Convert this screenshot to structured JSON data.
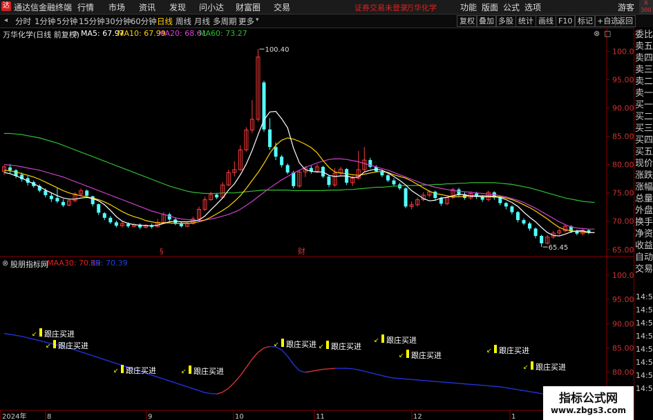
{
  "app": {
    "title": "通达信金融终端",
    "menu": [
      "行情",
      "市场",
      "资讯",
      "发现",
      "问小达",
      "财富圈",
      "交易"
    ],
    "status_msg": "证券交易未登录",
    "stock_name_red": "万华化学",
    "right_menu": [
      "功能",
      "版面",
      "公式",
      "选项"
    ],
    "guest": "游客",
    "corner": "R 300"
  },
  "toolbar": {
    "periods": [
      "分时",
      "1分钟",
      "5分钟",
      "15分钟",
      "30分钟",
      "60分钟",
      "日线",
      "周线",
      "月线",
      "多周期",
      "更多"
    ],
    "active_period": "日线",
    "right_buttons": [
      "复权",
      "叠加",
      "多股",
      "统计",
      "画线",
      "F10",
      "标记",
      "+自选",
      "返回"
    ]
  },
  "legend": {
    "stock": "万华化学(日线 前复权)",
    "ma5": "MA5: 67.97",
    "ma10": "MA10: 67.99",
    "ma20": "MA20: 68.61",
    "ma60": "MA60: 73.27",
    "colors": {
      "ma5": "#ffffff",
      "ma10": "#ffd200",
      "ma20": "#e040e0",
      "ma60": "#30c030"
    }
  },
  "indicator": {
    "name": "股朋指标网",
    "maa30": "MAA30: 70.39",
    "kb": "KB: 70.39",
    "signal_label": "跟庄买进"
  },
  "markers": {
    "s": "§",
    "cai": "财"
  },
  "annotations": {
    "high": "100.40",
    "low": "65.45"
  },
  "price_axis": [
    "100.0",
    "95.00",
    "90.00",
    "85.00",
    "80.00",
    "75.00",
    "70.00",
    "65.00"
  ],
  "ind_axis": [
    "100.0",
    "95.00",
    "90.00",
    "85.00",
    "80.00",
    "75.00"
  ],
  "x_labels": [
    "2024年",
    "8",
    "9",
    "10",
    "11",
    "12",
    "1"
  ],
  "right_panel": {
    "items": [
      "委比",
      "卖五",
      "卖四",
      "卖三",
      "卖二",
      "卖一",
      "买一",
      "买二",
      "买三",
      "买四",
      "买五",
      "现价",
      "涨跌",
      "涨幅",
      "总量",
      "外盘",
      "换手",
      "净资",
      "收益",
      "自动",
      "交易"
    ],
    "times": [
      "14:56",
      "14:56",
      "14:56",
      "14:56",
      "14:56",
      "14:56",
      "14:56",
      "14:56"
    ]
  },
  "watermark": {
    "line1": "指标公式网",
    "line2": "www.zbgs3.com"
  },
  "chart_data": {
    "type": "candlestick",
    "ylim": [
      64,
      102
    ],
    "candles": [
      [
        78.8,
        79.6,
        78.2,
        79.9
      ],
      [
        79.5,
        79.0,
        78.5,
        80.1
      ],
      [
        79.0,
        78.0,
        77.6,
        79.2
      ],
      [
        78.2,
        77.4,
        77.0,
        78.6
      ],
      [
        77.6,
        76.8,
        76.3,
        78.0
      ],
      [
        76.9,
        76.2,
        75.9,
        77.2
      ],
      [
        76.2,
        75.4,
        75.1,
        76.5
      ],
      [
        75.4,
        74.6,
        74.2,
        75.8
      ],
      [
        74.5,
        73.9,
        73.4,
        75.0
      ],
      [
        74.1,
        73.5,
        73.2,
        75.8
      ],
      [
        73.4,
        72.8,
        72.5,
        73.9
      ],
      [
        72.8,
        73.6,
        72.6,
        74.0
      ],
      [
        73.6,
        74.8,
        73.4,
        75.1
      ],
      [
        74.8,
        75.4,
        74.4,
        75.8
      ],
      [
        75.4,
        74.5,
        74.1,
        75.6
      ],
      [
        74.4,
        73.0,
        72.6,
        74.5
      ],
      [
        73.0,
        71.5,
        71.1,
        73.1
      ],
      [
        71.4,
        70.6,
        70.2,
        71.6
      ],
      [
        70.6,
        69.8,
        69.5,
        70.9
      ],
      [
        69.8,
        69.2,
        68.9,
        70.1
      ],
      [
        69.2,
        69.6,
        68.9,
        69.9
      ],
      [
        69.5,
        69.1,
        68.8,
        69.8
      ],
      [
        69.1,
        69.4,
        68.9,
        69.7
      ],
      [
        69.4,
        68.9,
        68.6,
        69.6
      ],
      [
        68.9,
        69.3,
        68.7,
        69.5
      ],
      [
        69.3,
        69.0,
        68.7,
        69.6
      ],
      [
        69.0,
        69.8,
        68.9,
        70.4
      ],
      [
        69.8,
        71.2,
        69.6,
        71.6
      ],
      [
        71.2,
        70.3,
        70.0,
        71.5
      ],
      [
        70.3,
        69.6,
        69.3,
        70.6
      ],
      [
        69.6,
        69.1,
        68.9,
        69.9
      ],
      [
        69.1,
        69.6,
        68.9,
        69.9
      ],
      [
        69.6,
        70.4,
        69.4,
        70.8
      ],
      [
        70.4,
        72.1,
        70.2,
        72.6
      ],
      [
        72.1,
        73.8,
        71.8,
        74.3
      ],
      [
        73.8,
        74.7,
        73.6,
        75.2
      ],
      [
        74.7,
        74.2,
        73.9,
        75.0
      ],
      [
        74.2,
        76.4,
        74.1,
        76.9
      ],
      [
        76.4,
        78.6,
        76.2,
        79.1
      ],
      [
        78.6,
        79.1,
        77.9,
        80.6
      ],
      [
        79.1,
        82.6,
        78.9,
        83.4
      ],
      [
        82.6,
        86.1,
        82.3,
        86.6
      ],
      [
        86.1,
        88.0,
        85.6,
        91.4
      ],
      [
        88.0,
        99.0,
        87.6,
        100.4
      ],
      [
        94.5,
        86.2,
        85.8,
        94.8
      ],
      [
        86.2,
        83.1,
        82.6,
        88.2
      ],
      [
        83.1,
        81.4,
        80.8,
        83.9
      ],
      [
        81.4,
        79.9,
        79.5,
        81.7
      ],
      [
        79.9,
        78.6,
        78.3,
        80.2
      ],
      [
        78.6,
        76.2,
        75.8,
        78.9
      ],
      [
        76.2,
        78.7,
        75.9,
        79.1
      ],
      [
        78.7,
        79.4,
        77.8,
        79.7
      ],
      [
        79.4,
        78.8,
        78.4,
        79.8
      ],
      [
        78.8,
        79.6,
        78.5,
        80.1
      ],
      [
        79.6,
        77.9,
        77.6,
        79.8
      ],
      [
        77.9,
        76.4,
        76.0,
        78.1
      ],
      [
        76.4,
        78.5,
        76.1,
        79.4
      ],
      [
        78.5,
        79.2,
        78.0,
        79.6
      ],
      [
        79.2,
        76.8,
        76.4,
        79.4
      ],
      [
        76.8,
        77.6,
        76.2,
        78.0
      ],
      [
        77.6,
        79.1,
        77.3,
        82.4
      ],
      [
        79.1,
        80.8,
        78.8,
        83.1
      ],
      [
        80.8,
        79.6,
        79.3,
        81.2
      ],
      [
        79.6,
        78.8,
        78.6,
        79.9
      ],
      [
        78.8,
        78.1,
        77.8,
        79.1
      ],
      [
        78.1,
        77.2,
        76.9,
        78.3
      ],
      [
        77.2,
        76.5,
        76.1,
        77.6
      ],
      [
        76.5,
        75.8,
        75.5,
        76.8
      ],
      [
        75.8,
        72.6,
        72.3,
        76.0
      ],
      [
        72.6,
        72.9,
        72.1,
        73.5
      ],
      [
        72.9,
        73.8,
        72.6,
        74.2
      ],
      [
        73.8,
        74.6,
        73.5,
        75.1
      ],
      [
        74.6,
        75.2,
        74.2,
        75.5
      ],
      [
        75.2,
        74.1,
        73.8,
        75.4
      ],
      [
        74.1,
        73.1,
        72.7,
        74.3
      ],
      [
        73.1,
        74.2,
        72.8,
        74.6
      ],
      [
        74.2,
        75.6,
        73.9,
        75.9
      ],
      [
        75.6,
        74.7,
        74.4,
        75.9
      ],
      [
        74.7,
        74.1,
        73.8,
        75.1
      ],
      [
        74.1,
        74.9,
        73.8,
        75.3
      ],
      [
        74.9,
        74.3,
        73.9,
        75.2
      ],
      [
        74.3,
        73.8,
        73.4,
        74.6
      ],
      [
        73.8,
        75.1,
        73.5,
        75.4
      ],
      [
        75.1,
        74.2,
        73.8,
        75.3
      ],
      [
        74.2,
        73.2,
        72.8,
        74.4
      ],
      [
        73.2,
        72.6,
        72.1,
        73.4
      ],
      [
        72.6,
        71.6,
        71.2,
        72.8
      ],
      [
        71.6,
        70.2,
        69.8,
        71.8
      ],
      [
        70.2,
        69.6,
        69.3,
        70.5
      ],
      [
        69.6,
        68.7,
        68.3,
        69.9
      ],
      [
        68.7,
        67.4,
        67.0,
        68.9
      ],
      [
        67.4,
        66.1,
        65.45,
        67.6
      ],
      [
        66.1,
        67.2,
        65.9,
        67.6
      ],
      [
        67.2,
        67.9,
        66.9,
        68.3
      ],
      [
        67.9,
        68.3,
        67.6,
        68.7
      ],
      [
        68.3,
        69.1,
        68.0,
        69.5
      ],
      [
        69.1,
        68.2,
        67.9,
        69.3
      ],
      [
        68.2,
        67.8,
        67.5,
        68.5
      ],
      [
        67.8,
        68.4,
        67.5,
        68.8
      ],
      [
        68.4,
        68.0,
        67.7,
        68.6
      ]
    ],
    "ma5": [
      78.6,
      78.4,
      78.0,
      77.6,
      77.1,
      76.6,
      76.1,
      75.5,
      75.0,
      74.5,
      74.1,
      73.9,
      73.9,
      74.1,
      74.2,
      74.0,
      73.6,
      72.9,
      71.9,
      70.8,
      70.0,
      69.6,
      69.4,
      69.3,
      69.2,
      69.2,
      69.3,
      69.6,
      69.9,
      70.0,
      69.9,
      69.9,
      70.0,
      70.2,
      70.9,
      72.0,
      73.0,
      74.1,
      75.5,
      76.6,
      78.2,
      80.1,
      82.5,
      85.3,
      87.9,
      89.3,
      89.4,
      88.1,
      86.5,
      82.9,
      80.3,
      79.1,
      78.8,
      78.7,
      78.7,
      78.1,
      77.9,
      78.0,
      78.0,
      77.7,
      77.8,
      78.7,
      79.0,
      79.2,
      79.0,
      78.5,
      77.9,
      77.2,
      76.4,
      75.4,
      74.7,
      74.0,
      73.6,
      73.7,
      74.1,
      74.2,
      74.5,
      74.7,
      74.7,
      74.4,
      74.4,
      74.3,
      74.3,
      74.3,
      74.2,
      73.8,
      73.3,
      72.6,
      71.6,
      70.7,
      69.9,
      68.9,
      68.0,
      67.5,
      67.4,
      67.7,
      68.1,
      68.3,
      68.3,
      68.0,
      68.0
    ],
    "ma10": [
      79.0,
      78.9,
      78.7,
      78.4,
      78.1,
      77.8,
      77.4,
      76.9,
      76.4,
      75.9,
      75.4,
      75.0,
      74.7,
      74.5,
      74.3,
      74.1,
      73.8,
      73.4,
      72.9,
      72.3,
      71.7,
      71.2,
      70.8,
      70.5,
      70.1,
      69.9,
      69.7,
      69.7,
      69.7,
      69.6,
      69.6,
      69.6,
      69.7,
      69.9,
      70.2,
      70.7,
      71.3,
      71.9,
      72.6,
      73.5,
      74.5,
      75.8,
      77.2,
      78.6,
      80.2,
      82.0,
      83.4,
      84.3,
      84.7,
      84.5,
      84.1,
      83.6,
      83.0,
      82.1,
      80.7,
      79.5,
      78.7,
      78.5,
      78.4,
      78.2,
      78.1,
      78.3,
      78.5,
      78.7,
      78.8,
      78.6,
      78.2,
      77.9,
      77.6,
      77.1,
      76.5,
      75.9,
      75.3,
      74.9,
      74.7,
      74.5,
      74.3,
      74.3,
      74.4,
      74.5,
      74.5,
      74.5,
      74.5,
      74.4,
      74.3,
      74.1,
      73.8,
      73.4,
      72.9,
      72.4,
      71.8,
      71.1,
      70.4,
      69.6,
      68.9,
      68.5,
      68.3,
      68.2,
      68.1,
      68.0,
      68.0
    ],
    "ma20": [
      80.0,
      79.9,
      79.8,
      79.6,
      79.4,
      79.2,
      79.0,
      78.7,
      78.4,
      78.1,
      77.8,
      77.4,
      77.0,
      76.6,
      76.2,
      75.8,
      75.4,
      75.0,
      74.6,
      74.2,
      73.8,
      73.4,
      73.0,
      72.6,
      72.2,
      71.8,
      71.5,
      71.2,
      70.9,
      70.6,
      70.4,
      70.3,
      70.2,
      70.1,
      70.2,
      70.4,
      70.6,
      70.9,
      71.2,
      71.6,
      72.1,
      72.8,
      73.5,
      74.3,
      75.1,
      75.9,
      76.6,
      77.3,
      77.9,
      78.5,
      79.0,
      79.5,
      79.9,
      80.3,
      80.6,
      80.9,
      81.0,
      81.0,
      80.9,
      80.7,
      80.5,
      80.2,
      79.9,
      79.6,
      79.3,
      79.0,
      78.6,
      78.2,
      77.8,
      77.4,
      77.0,
      76.6,
      76.3,
      76.0,
      75.8,
      75.6,
      75.4,
      75.3,
      75.2,
      75.1,
      75.0,
      74.9,
      74.8,
      74.7,
      74.5,
      74.3,
      74.0,
      73.7,
      73.3,
      72.8,
      72.3,
      71.7,
      71.1,
      70.5,
      69.9,
      69.4,
      69.0,
      68.8,
      68.7,
      68.6,
      68.6
    ],
    "ma60": [
      85.5,
      85.5,
      85.4,
      85.3,
      85.1,
      84.9,
      84.7,
      84.4,
      84.1,
      83.8,
      83.4,
      83.0,
      82.6,
      82.2,
      81.8,
      81.4,
      81.0,
      80.6,
      80.2,
      79.8,
      79.4,
      79.0,
      78.6,
      78.2,
      77.8,
      77.4,
      77.0,
      76.6,
      76.2,
      75.9,
      75.6,
      75.3,
      75.1,
      75.0,
      74.9,
      74.9,
      74.9,
      75.0,
      75.0,
      75.0,
      75.1,
      75.2,
      75.3,
      75.4,
      75.5,
      75.5,
      75.5,
      75.5,
      75.5,
      75.4,
      75.4,
      75.4,
      75.4,
      75.4,
      75.4,
      75.5,
      75.5,
      75.5,
      75.6,
      75.6,
      75.7,
      75.8,
      75.9,
      76.0,
      76.0,
      76.1,
      76.2,
      76.2,
      76.3,
      76.3,
      76.3,
      76.4,
      76.4,
      76.5,
      76.5,
      76.6,
      76.6,
      76.7,
      76.7,
      76.8,
      76.8,
      76.8,
      76.8,
      76.8,
      76.7,
      76.6,
      76.5,
      76.3,
      76.1,
      75.9,
      75.6,
      75.3,
      75.0,
      74.7,
      74.4,
      74.1,
      73.9,
      73.7,
      73.5,
      73.4,
      73.3
    ],
    "indicator_line": [
      88,
      87.8,
      87.6,
      87.4,
      87.1,
      86.8,
      86.5,
      86.2,
      85.9,
      85.6,
      85.3,
      85.0,
      84.6,
      84.2,
      83.8,
      83.4,
      83.0,
      82.6,
      82.2,
      81.8,
      81.4,
      81.0,
      80.6,
      80.2,
      79.8,
      79.4,
      79.0,
      78.6,
      78.2,
      77.8,
      77.4,
      77.0,
      76.6,
      76.2,
      75.8,
      75.6,
      75.5,
      75.9,
      76.7,
      77.9,
      79.3,
      81.0,
      82.7,
      84.1,
      85.0,
      85.3,
      85.2,
      84.6,
      83.3,
      81.6,
      80.3,
      80.0,
      80.2,
      80.4,
      80.6,
      80.7,
      80.8,
      80.8,
      80.8,
      80.7,
      80.5,
      80.2,
      79.9,
      79.6,
      79.3,
      79.0,
      78.8,
      78.7,
      78.6,
      78.5,
      78.4,
      78.3,
      78.2,
      78.1,
      78.0,
      77.9,
      77.8,
      77.7,
      77.6,
      77.5,
      77.4,
      77.3,
      77.2,
      77.1,
      77.0,
      76.8,
      76.6,
      76.4,
      76.2,
      76.0,
      75.8,
      75.6,
      75.4,
      75.2,
      75.0,
      74.8,
      74.6,
      74.4,
      74.2,
      74.0,
      73.8
    ]
  }
}
